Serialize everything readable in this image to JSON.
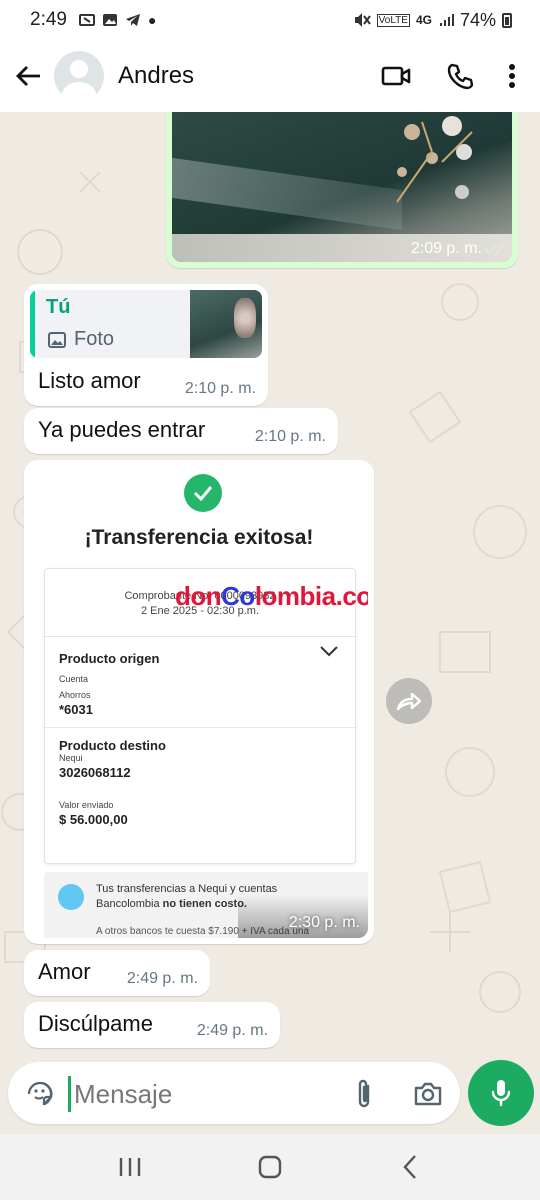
{
  "status_bar": {
    "time": "2:49",
    "network": "4G",
    "battery": "74%"
  },
  "header": {
    "contact_name": "Andres",
    "icons": [
      "back-arrow-icon",
      "avatar",
      "video-call-icon",
      "phone-icon",
      "more-options-icon"
    ]
  },
  "messages": [
    {
      "type": "image",
      "direction": "outgoing",
      "time": "2:09 p. m.",
      "status": "delivered"
    },
    {
      "type": "reply",
      "direction": "incoming",
      "quote_author": "Tú",
      "quote_type": "Foto",
      "text": "Listo amor",
      "time": "2:10 p. m."
    },
    {
      "type": "text",
      "direction": "incoming",
      "text": "Ya puedes entrar",
      "time": "2:10 p. m."
    },
    {
      "type": "image",
      "direction": "incoming",
      "time": "2:30 p. m.",
      "content": {
        "title": "¡Transferencia exitosa!",
        "receipt_label": "Comprobante No. 0000093982",
        "receipt_date": "2 Ene 2025 - 02:30 p.m.",
        "watermark_red1": "don",
        "watermark_blue": "Co",
        "watermark_red2": "lombia.com",
        "origin_title": "Producto origen",
        "origin_account_label": "Cuenta",
        "origin_account_type": "Ahorros",
        "origin_account_number": "*6031",
        "dest_title": "Producto destino",
        "dest_bank": "Nequi",
        "dest_number": "3026068112",
        "amount_label": "Valor enviado",
        "amount": "$ 56.000,00",
        "tip_text_a": "Tus transferencias a Nequi y cuentas Bancolombia ",
        "tip_text_b": "no tienen costo.",
        "tip_text_c": "A otros bancos te cuesta $7.190 + IVA cada una"
      }
    },
    {
      "type": "text",
      "direction": "incoming",
      "text": "Amor",
      "time": "2:49 p. m."
    },
    {
      "type": "text",
      "direction": "incoming",
      "text": "Discúlpame",
      "time": "2:49 p. m."
    }
  ],
  "input": {
    "placeholder": "Mensaje"
  },
  "colors": {
    "accent": "#1daa61",
    "outgoing_bubble": "#d9fdd3",
    "chat_background": "#efeae2",
    "quote_author": "#06a17a"
  }
}
